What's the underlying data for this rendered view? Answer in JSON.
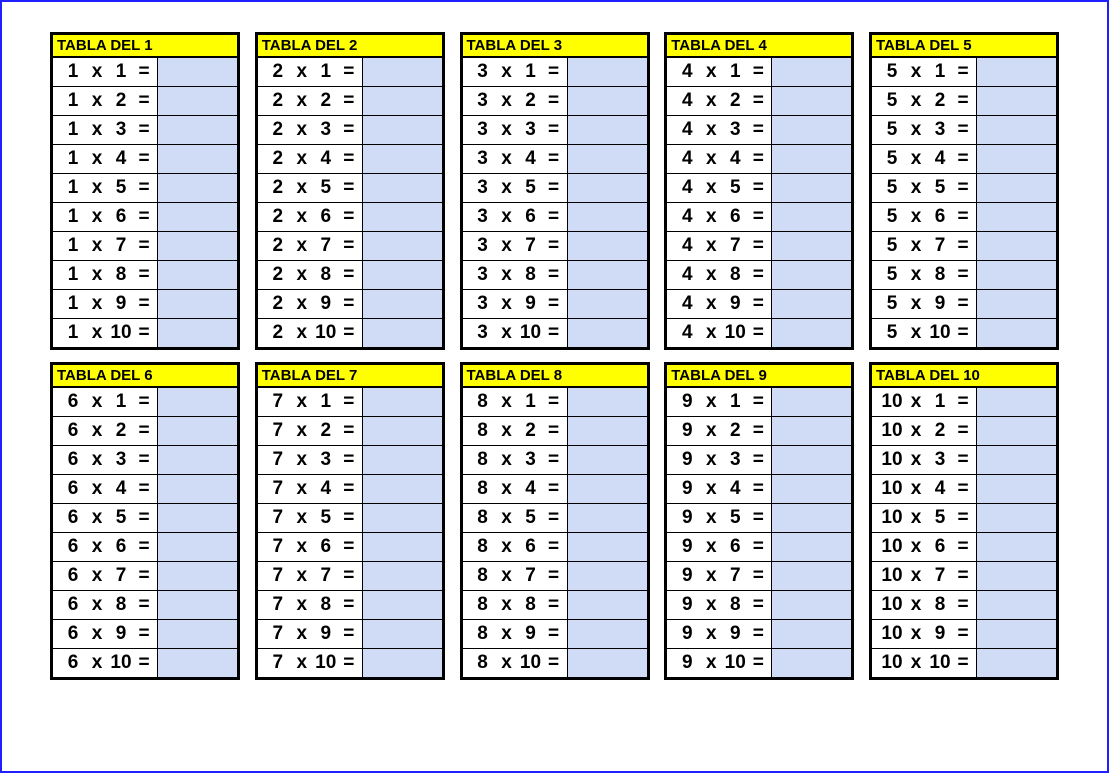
{
  "title_prefix": "TABLA DEL ",
  "op_symbol": "x",
  "eq_symbol": "=",
  "tables": [
    {
      "n": 1,
      "title": "TABLA DEL 1",
      "rows": [
        1,
        2,
        3,
        4,
        5,
        6,
        7,
        8,
        9,
        10
      ]
    },
    {
      "n": 2,
      "title": "TABLA DEL 2",
      "rows": [
        1,
        2,
        3,
        4,
        5,
        6,
        7,
        8,
        9,
        10
      ]
    },
    {
      "n": 3,
      "title": "TABLA DEL 3",
      "rows": [
        1,
        2,
        3,
        4,
        5,
        6,
        7,
        8,
        9,
        10
      ]
    },
    {
      "n": 4,
      "title": "TABLA DEL 4",
      "rows": [
        1,
        2,
        3,
        4,
        5,
        6,
        7,
        8,
        9,
        10
      ]
    },
    {
      "n": 5,
      "title": "TABLA DEL 5",
      "rows": [
        1,
        2,
        3,
        4,
        5,
        6,
        7,
        8,
        9,
        10
      ]
    },
    {
      "n": 6,
      "title": "TABLA DEL 6",
      "rows": [
        1,
        2,
        3,
        4,
        5,
        6,
        7,
        8,
        9,
        10
      ]
    },
    {
      "n": 7,
      "title": "TABLA DEL 7",
      "rows": [
        1,
        2,
        3,
        4,
        5,
        6,
        7,
        8,
        9,
        10
      ]
    },
    {
      "n": 8,
      "title": "TABLA DEL 8",
      "rows": [
        1,
        2,
        3,
        4,
        5,
        6,
        7,
        8,
        9,
        10
      ]
    },
    {
      "n": 9,
      "title": "TABLA DEL 9",
      "rows": [
        1,
        2,
        3,
        4,
        5,
        6,
        7,
        8,
        9,
        10
      ]
    },
    {
      "n": 10,
      "title": "TABLA DEL 10",
      "rows": [
        1,
        2,
        3,
        4,
        5,
        6,
        7,
        8,
        9,
        10
      ]
    }
  ],
  "colors": {
    "border": "#2020ff",
    "card_border": "#000000",
    "title_bg": "#ffff00",
    "answer_bg": "#d0dcf5"
  }
}
